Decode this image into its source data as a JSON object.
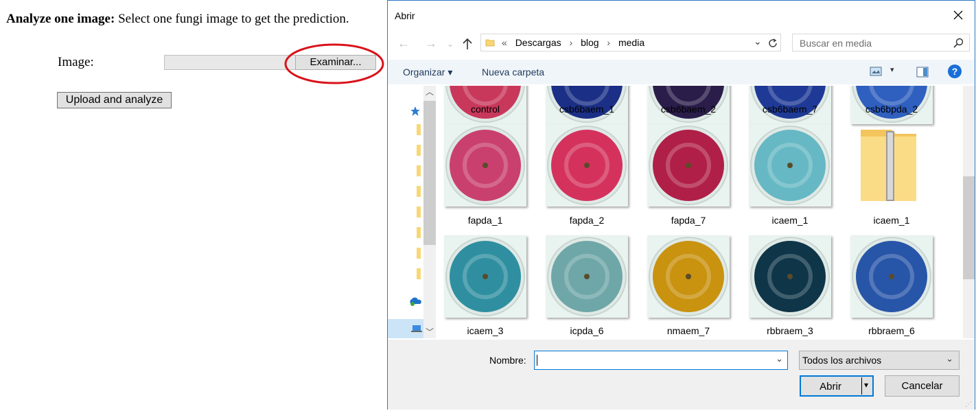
{
  "webpage": {
    "heading_bold": "Analyze one image:",
    "heading_text": " Select one fungi image to get the prediction.",
    "image_label": "Image:",
    "browse_button": "Examinar...",
    "upload_button": "Upload and analyze",
    "highlight_color": "#d9121a"
  },
  "dialog": {
    "title": "Abrir",
    "breadcrumbs": [
      "Descargas",
      "blog",
      "media"
    ],
    "breadcrumb_prefix": "«",
    "search_placeholder": "Buscar en media",
    "toolbar": {
      "organize": "Organizar ▾",
      "new_folder": "Nueva carpeta"
    },
    "files": [
      {
        "name": "control",
        "color": "#c8385b"
      },
      {
        "name": "csb6baem_1",
        "color": "#1b2f86"
      },
      {
        "name": "csb6baem_2",
        "color": "#2a1d4a"
      },
      {
        "name": "csb6baem_7",
        "color": "#1f3a96"
      },
      {
        "name": "csb6bpda_2",
        "color": "#2f5fbf"
      },
      {
        "name": "fapda_1",
        "color": "#c9406e"
      },
      {
        "name": "fapda_2",
        "color": "#d4325d"
      },
      {
        "name": "fapda_7",
        "color": "#b01f47"
      },
      {
        "name": "icaem_1",
        "color": "#66b8c4"
      },
      {
        "name": "icaem_1",
        "color": "#f5c86a"
      },
      {
        "name": "icaem_3",
        "color": "#2f8fa0"
      },
      {
        "name": "icpda_6",
        "color": "#6fa7a8"
      },
      {
        "name": "nmaem_7",
        "color": "#c9920f"
      },
      {
        "name": "rbbraem_3",
        "color": "#0e3548"
      },
      {
        "name": "rbbraem_6",
        "color": "#2755a8"
      }
    ],
    "filename_label": "Nombre:",
    "filename_value": "",
    "filetype": "Todos los archivos",
    "open_button": "Abrir",
    "cancel_button": "Cancelar",
    "accent": "#0078d7"
  }
}
